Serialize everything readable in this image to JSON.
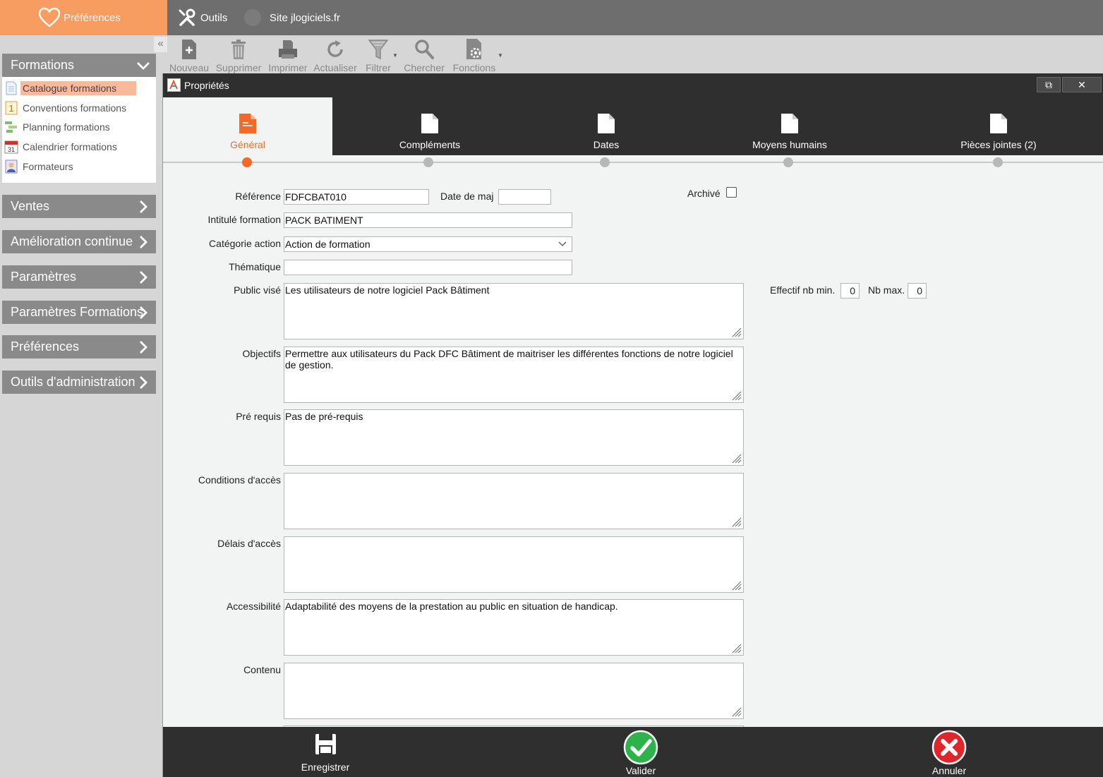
{
  "topbar": {
    "preferences_label": "Préférences",
    "tools_label": "Outils",
    "site_label": "Site jlogiciels.fr"
  },
  "sidebar": {
    "collapse_glyph": "«",
    "formations": {
      "title": "Formations",
      "items": [
        {
          "label": "Catalogue formations",
          "icon": "document-icon",
          "active": true
        },
        {
          "label": "Conventions formations",
          "icon": "number-one-icon"
        },
        {
          "label": "Planning formations",
          "icon": "gantt-icon"
        },
        {
          "label": "Calendrier formations",
          "icon": "calendar-icon"
        },
        {
          "label": "Formateurs",
          "icon": "trainer-icon"
        }
      ]
    },
    "sections": [
      "Ventes",
      "Amélioration continue",
      "Paramètres",
      "Paramètres Formations",
      "Préférences",
      "Outils d'administration"
    ]
  },
  "toolbar": {
    "buttons": [
      "Nouveau",
      "Supprimer",
      "Imprimer",
      "Actualiser",
      "Filtrer",
      "Chercher",
      "Fonctions"
    ]
  },
  "window": {
    "title": "Propriétés",
    "restore_glyph": "⧉",
    "close_glyph": "✕",
    "tabs": [
      "Général",
      "Compléments",
      "Dates",
      "Moyens humains",
      "Pièces jointes (2)"
    ]
  },
  "form": {
    "reference": {
      "label": "Référence",
      "value": "FDFCBAT010"
    },
    "date_maj": {
      "label": "Date de maj",
      "value": ""
    },
    "archive": {
      "label": "Archivé",
      "checked": false
    },
    "intitule": {
      "label": "Intitulé formation",
      "value": "PACK BATIMENT"
    },
    "categorie": {
      "label": "Catégorie action",
      "value": "Action de formation"
    },
    "thematique": {
      "label": "Thématique",
      "value": ""
    },
    "public": {
      "label": "Public visé",
      "value": "Les utilisateurs de notre logiciel Pack Bâtiment"
    },
    "effectif_min": {
      "label": "Effectif nb min.",
      "value": "0"
    },
    "effectif_max": {
      "label": "Nb max.",
      "value": "0"
    },
    "objectifs": {
      "label": "Objectifs",
      "value": "Permettre aux utilisateurs du Pack DFC Bâtiment de maitriser les différentes fonctions de notre logiciel de gestion."
    },
    "prerequis": {
      "label": "Pré requis",
      "value": "Pas de pré-requis"
    },
    "conditions": {
      "label": "Conditions d'accès",
      "value": ""
    },
    "delais": {
      "label": "Délais d'accès",
      "value": ""
    },
    "accessibilite": {
      "label": "Accessibilité",
      "value": "Adaptabilité des moyens de la prestation au public en situation de handicap."
    },
    "contenu": {
      "label": "Contenu",
      "value": ""
    }
  },
  "footer": {
    "save_label": "Enregistrer",
    "validate_label": "Valider",
    "cancel_label": "Annuler"
  },
  "colors": {
    "accent": "#f26a2a",
    "preferences_bg": "#f79d61",
    "dark": "#2f2f2f",
    "validate": "#2db34a",
    "cancel": "#e0252b"
  }
}
